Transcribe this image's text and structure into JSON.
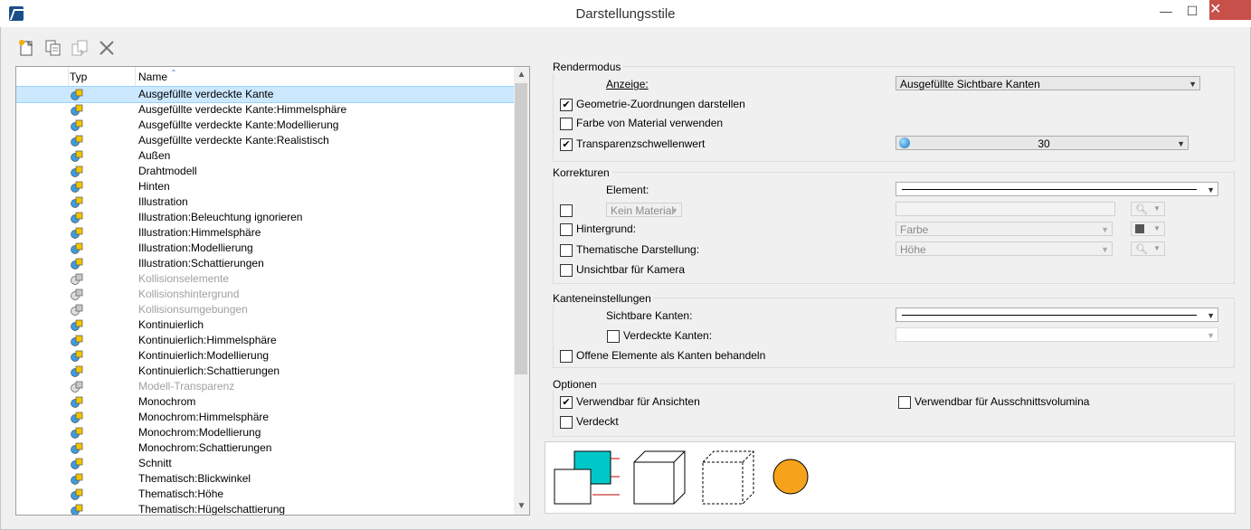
{
  "window": {
    "title": "Darstellungsstile",
    "minimize": "—",
    "maximize": "☐",
    "close": "✕"
  },
  "toolbar": {
    "new_icon": "new-icon",
    "copy_icon": "copy-icon",
    "paste_icon": "paste-icon",
    "delete_icon": "delete-icon"
  },
  "list": {
    "columns": [
      "Typ",
      "Name"
    ],
    "sort_indicator": "ˆ",
    "rows": [
      {
        "name": "Ausgefüllte verdeckte Kante",
        "selected": true
      },
      {
        "name": "Ausgefüllte verdeckte Kante:Himmelsphäre"
      },
      {
        "name": "Ausgefüllte verdeckte Kante:Modellierung"
      },
      {
        "name": "Ausgefüllte verdeckte Kante:Realistisch"
      },
      {
        "name": "Außen"
      },
      {
        "name": "Drahtmodell"
      },
      {
        "name": "Hinten"
      },
      {
        "name": "Illustration"
      },
      {
        "name": "Illustration:Beleuchtung ignorieren"
      },
      {
        "name": "Illustration:Himmelsphäre"
      },
      {
        "name": "Illustration:Modellierung"
      },
      {
        "name": "Illustration:Schattierungen"
      },
      {
        "name": "Kollisionselemente",
        "disabled": true
      },
      {
        "name": "Kollisionshintergrund",
        "disabled": true
      },
      {
        "name": "Kollisionsumgebungen",
        "disabled": true
      },
      {
        "name": "Kontinuierlich"
      },
      {
        "name": "Kontinuierlich:Himmelsphäre"
      },
      {
        "name": "Kontinuierlich:Modellierung"
      },
      {
        "name": "Kontinuierlich:Schattierungen"
      },
      {
        "name": "Modell-Transparenz",
        "disabled": true
      },
      {
        "name": "Monochrom"
      },
      {
        "name": "Monochrom:Himmelsphäre"
      },
      {
        "name": "Monochrom:Modellierung"
      },
      {
        "name": "Monochrom:Schattierungen"
      },
      {
        "name": "Schnitt"
      },
      {
        "name": "Thematisch:Blickwinkel"
      },
      {
        "name": "Thematisch:Höhe"
      },
      {
        "name": "Thematisch:Hügelschattierung"
      }
    ]
  },
  "render": {
    "title": "Rendermodus",
    "anzeige_label": "Anzeige:",
    "anzeige_value": "Ausgefüllte Sichtbare Kanten",
    "geometrie_label": "Geometrie-Zuordnungen darstellen",
    "farbe_label": "Farbe von Material verwenden",
    "transparenz_label": "Transparenzschwellenwert",
    "transparenz_value": "30"
  },
  "korrekturen": {
    "title": "Korrekturen",
    "element_label": "Element:",
    "material_value": "Kein Material",
    "hintergrund_label": "Hintergrund:",
    "hintergrund_value": "Farbe",
    "thematisch_label": "Thematische Darstellung:",
    "thematisch_value": "Höhe",
    "unsichtbar_label": "Unsichtbar für Kamera"
  },
  "kanten": {
    "title": "Kanteneinstellungen",
    "sichtbar_label": "Sichtbare Kanten:",
    "verdeckt_label": "Verdeckte Kanten:",
    "offene_label": "Offene Elemente als Kanten behandeln"
  },
  "optionen": {
    "title": "Optionen",
    "ansichten_label": "Verwendbar für Ansichten",
    "ausschnitt_label": "Verwendbar für Ausschnittsvolumina",
    "verdeckt_label": "Verdeckt"
  },
  "colors": {
    "preview_cyan": "#00c8c8",
    "preview_orange": "#f7a21b",
    "preview_edge": "#c00000"
  }
}
